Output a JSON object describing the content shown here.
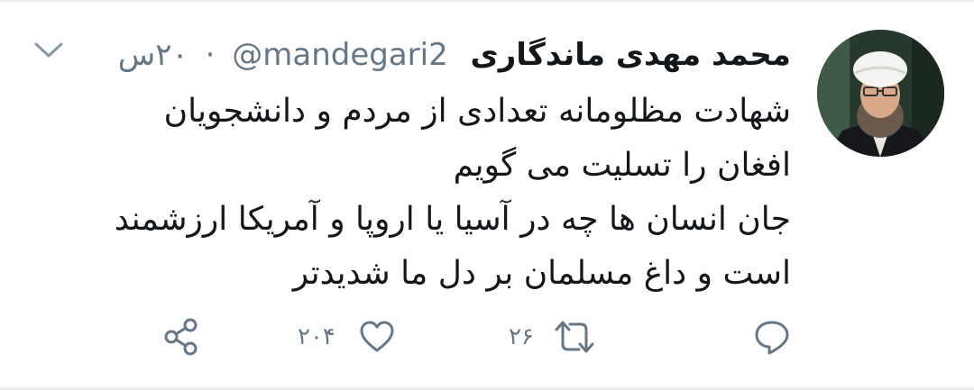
{
  "tweet": {
    "display_name": "محمد مهدی ماندگاری",
    "handle": "@mandegari2",
    "separator": "·",
    "timestamp": "۲۰س",
    "lines": [
      "شهادت مظلومانه تعدادی از مردم و دانشجویان",
      "افغان را تسلیت می گویم",
      "جان انسان ها چه در آسیا یا اروپا و آمریکا ارزشمند",
      "است و داغ مسلمان بر دل ما شدیدتر"
    ]
  },
  "actions": {
    "reply_count": "",
    "retweet_count": "۲۶",
    "like_count": "۲۰۴"
  },
  "icons": {
    "menu": "chevron-down-icon",
    "reply": "reply-icon",
    "retweet": "retweet-icon",
    "like": "heart-icon",
    "share": "share-icon"
  },
  "colors": {
    "text": "#14171a",
    "secondary": "#657786",
    "divider": "#e6ecf0"
  }
}
